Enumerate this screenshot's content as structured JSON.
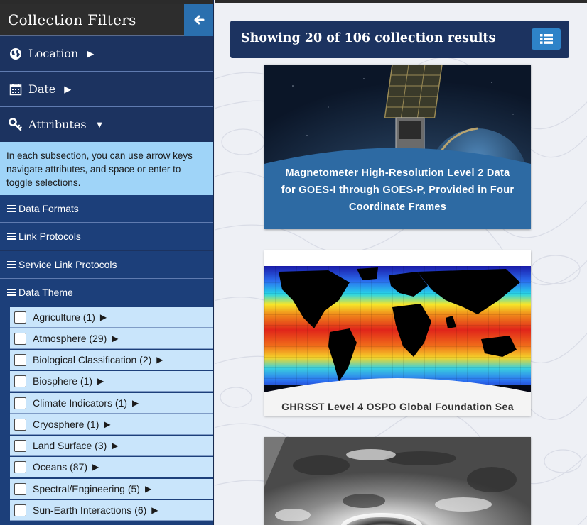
{
  "sidebar": {
    "title": "Collection Filters",
    "sections": [
      {
        "label": "Location",
        "arrow": "▶"
      },
      {
        "label": "Date",
        "arrow": "▶"
      },
      {
        "label": "Attributes",
        "arrow": "▼"
      }
    ],
    "attributes_help": "In each subsection, you can use arrow keys navigate attributes, and space or enter to toggle selections.",
    "subsections": [
      "Data Formats",
      "Link Protocols",
      "Service Link Protocols",
      "Data Theme"
    ],
    "theme_items": [
      {
        "label": "Agriculture (1)",
        "checked": false
      },
      {
        "label": "Atmosphere (29)",
        "checked": false
      },
      {
        "label": "Biological Classification (2)",
        "checked": false
      },
      {
        "label": "Biosphere (1)",
        "checked": false
      },
      {
        "label": "Climate Indicators (1)",
        "checked": false
      },
      {
        "label": "Cryosphere (1)",
        "checked": false
      },
      {
        "label": "Land Surface (3)",
        "checked": false
      },
      {
        "label": "Oceans (87)",
        "checked": false
      },
      {
        "label": "Spectral/Engineering (5)",
        "checked": false
      },
      {
        "label": "Sun-Earth Interactions (6)",
        "checked": false
      }
    ],
    "item_arrow": "▶"
  },
  "results": {
    "summary": "Showing 20 of 106 collection results",
    "cards": [
      {
        "title": "Magnetometer High-Resolution Level 2 Data for GOES-I through GOES-P, Provided in Four Coordinate Frames"
      },
      {
        "title": "GHRSST Level 4 OSPO Global Foundation Sea"
      }
    ]
  },
  "colors": {
    "navy": "#1c3360",
    "accent_blue": "#2e83c8",
    "help_bg": "#9fd4f8",
    "item_bg": "#c9e5fb"
  },
  "icons": {
    "collapse": "arrow-left-icon",
    "location": "globe-icon",
    "date": "calendar-icon",
    "attributes": "key-icon",
    "list_view": "list-icon",
    "subsection": "bars-icon"
  }
}
